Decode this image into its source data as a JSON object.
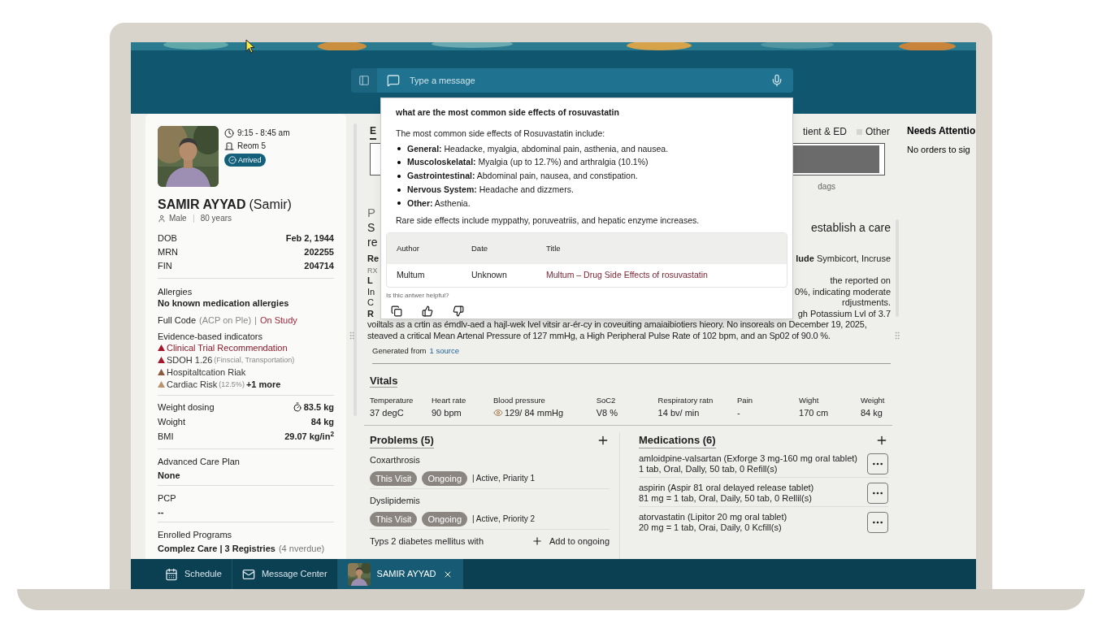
{
  "chat": {
    "placeholder": "Type a message"
  },
  "patient": {
    "time": "9:15 - 8:45 am",
    "room": "Reom 5",
    "status": "Arrived",
    "name": "SAMIR AYYAD",
    "preferred": "(Samir)",
    "sex": "Male",
    "age": "80 years",
    "ids": [
      {
        "label": "DOB",
        "value": "Feb 2, 1944"
      },
      {
        "label": "MRN",
        "value": "202255"
      },
      {
        "label": "FIN",
        "value": "204714"
      }
    ],
    "allergies": {
      "label": "Allergies",
      "value": "No known medication allergies"
    },
    "code": {
      "text": "Full Code",
      "note": "(ACP on Ple)",
      "separator": "|",
      "study": "On Study"
    },
    "indicators": {
      "label": "Evidence-based indicators",
      "items": [
        {
          "name": "Clinical Trial Recommendation",
          "highlighted": true,
          "color": "#a3182b"
        },
        {
          "name": "SDOH 1.26",
          "detail": "(Finscial, Transportation)",
          "highlighted": false,
          "color": "#a3182b"
        },
        {
          "name": "Hospitaltcation Riak",
          "highlighted": false,
          "color": "#8a5a3c"
        },
        {
          "name": "Cardiac Risk",
          "detail": "(12.5%)",
          "more": "+1 more",
          "highlighted": false,
          "color": "#b8946a"
        }
      ]
    },
    "measures": [
      {
        "label": "Weight dosing",
        "value": "83.5 kg",
        "kind": "dosing"
      },
      {
        "label": "Woight",
        "value": "84 kg",
        "kind": "plain"
      },
      {
        "label": "BMI",
        "value": "29.07 kg/in$^{2}$",
        "kind": "plain"
      }
    ],
    "sections": [
      {
        "label": "Advanced Care Plan",
        "value": "None"
      },
      {
        "label": "PCP",
        "value": "--"
      },
      {
        "label": "Enrolled Programs",
        "value": "Complez Care | 3 Registries",
        "note": "(4 nverdue)"
      }
    ]
  },
  "encounters": {
    "tab": "E",
    "legend": [
      {
        "label": "tient & ED"
      },
      {
        "label": "Other",
        "color": "#d4d4d4"
      }
    ],
    "axis_fragment": "dags"
  },
  "summary": {
    "rows": [
      {
        "kind": "label",
        "left": "P"
      },
      {
        "kind": "title",
        "left": "S",
        "right": "establish a care"
      },
      {
        "kind": "title",
        "left": "re"
      },
      {
        "kind": "body",
        "left": "**Re**",
        "right": "**lude** Symbicort, Incruse"
      },
      {
        "kind": "note",
        "left": "RX"
      },
      {
        "kind": "body",
        "left": "**L**",
        "right": "the reported on"
      },
      {
        "kind": "body",
        "left": "In",
        "right": "0%, indicating moderate"
      },
      {
        "kind": "body",
        "left": "C",
        "right": "rdjustments."
      },
      {
        "kind": "body",
        "left": "**R**",
        "right": "gh Potassium Lvl of 3.7"
      }
    ],
    "lines": [
      "voiltals as a crtin as émdlv-aed a hajl-wek lvel vitsir ar-ér-cy in coveuiting amaiaibiotiers hieory. No insoreals on December 19, 2025,",
      "steaved a critical Mean Artenal Pressure of 127 mmHg, a High Peripheral Pulse Rate of 102 bpm, and an Sp02 of 90.0 %."
    ],
    "source_prefix": "Generated from",
    "source_link": "1 source"
  },
  "answer": {
    "question": "what are the most common side effects of rosuvastatin",
    "intro": "The most common side effects of Rosuvastatin include:",
    "bullets": [
      "**General:** Headacke, myalgia, abdominal pain, asthenia, and nausea.",
      "**Muscoloskelatal:** Myalgia (up to 12.7%) and arthralgia (10.1%)",
      "**Gastrointestinal:** Abdominal pain, nausea, and constipation.",
      "**Nervous System:** Headache and dizzmers.",
      "**Other:** Asthenia."
    ],
    "closing": "Rare side effects include myppathy, poruveatriis, and hepatic enzyme increases.",
    "sources": {
      "columns": [
        "Author",
        "Date",
        "Title"
      ],
      "rows": [
        [
          "Multum",
          "Unknown",
          "Multum – Drug Side Effects of rosuvastatin"
        ]
      ]
    },
    "feedback": "Is thic antwer helpful?"
  },
  "vitals": {
    "title": "Vitals",
    "items": [
      {
        "label": "Temperature",
        "value": "37 degC",
        "kind": "plain"
      },
      {
        "label": "Heart rate",
        "value": "90 bpm",
        "kind": "plain"
      },
      {
        "label": "Blood pressure",
        "value": "129/ 84 mmHg",
        "kind": "flagged"
      },
      {
        "label": "SoC2",
        "value": "V8 %",
        "kind": "plain"
      },
      {
        "label": "Respiratory ratn",
        "value": "14 bv/ min",
        "kind": "plain"
      },
      {
        "label": "Pain",
        "value": "-",
        "kind": "plain"
      },
      {
        "label": "Wight",
        "value": "170 cm",
        "kind": "plain"
      },
      {
        "label": "Weight",
        "value": "84 kg",
        "kind": "plain"
      }
    ]
  },
  "problems": {
    "title": "Problems (5)",
    "items": [
      {
        "name": "Coxarthrosis",
        "tags": [
          "This Visit",
          "Ongoing"
        ],
        "status": "| Active, Priarity 1"
      },
      {
        "name": "Dyslipidemis",
        "tags": [
          "This Visit",
          "Ongoing"
        ],
        "status": "| Active, Priority 2"
      },
      {
        "name": "Typs 2 diabetes mellitus with",
        "action": "Add to ongoing"
      }
    ]
  },
  "medications": {
    "title": "Medications (6)",
    "items": [
      {
        "name": "amloidpine-valsartan (Exforge 3 mg-160 mg oral tablet)",
        "sig": "1 tab, Oral, Dally, 50 tab, 0 Refill(s)"
      },
      {
        "name": "aspirin (Aspir 81 oral delayed release tablet)",
        "sig": "81 mg = 1 tab, Oral, Daily, 50 tab, 0 Rellil(s)"
      },
      {
        "name": "atorvastatin (Lipitor 20 mg oral tablet)",
        "sig": "20 mg = 1 tab, Orai, Daily, 0 Kcfill(s)"
      }
    ]
  },
  "attention": {
    "title": "Needs Attentio",
    "body": "No orders to sig"
  },
  "taskbar": [
    {
      "label": "Schedule",
      "kind": "schedule",
      "selected": false
    },
    {
      "label": "Message Center",
      "kind": "messages",
      "selected": false
    },
    {
      "label": "SAMIR AYYAD",
      "kind": "patient",
      "selected": true
    }
  ]
}
